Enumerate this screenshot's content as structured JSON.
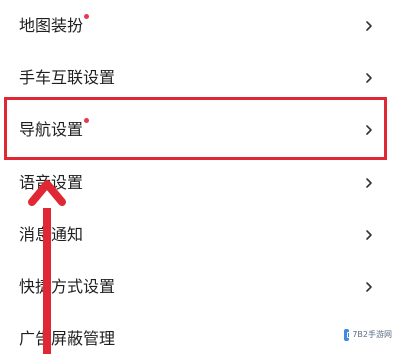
{
  "settings_menu": {
    "items": [
      {
        "label": "地图装扮",
        "has_badge": true
      },
      {
        "label": "手车互联设置",
        "has_badge": false
      },
      {
        "label": "导航设置",
        "has_badge": true
      },
      {
        "label": "语音设置",
        "has_badge": false
      },
      {
        "label": "消息通知",
        "has_badge": false
      },
      {
        "label": "快捷方式设置",
        "has_badge": false
      },
      {
        "label": "广告屏蔽管理",
        "has_badge": false
      }
    ],
    "chevron_icon": "chevron-right-icon",
    "badge_color": "#e8384f"
  },
  "annotation": {
    "highlighted_item": "导航设置",
    "color": "#e02834"
  },
  "watermark": {
    "text": "7B2手游网"
  }
}
